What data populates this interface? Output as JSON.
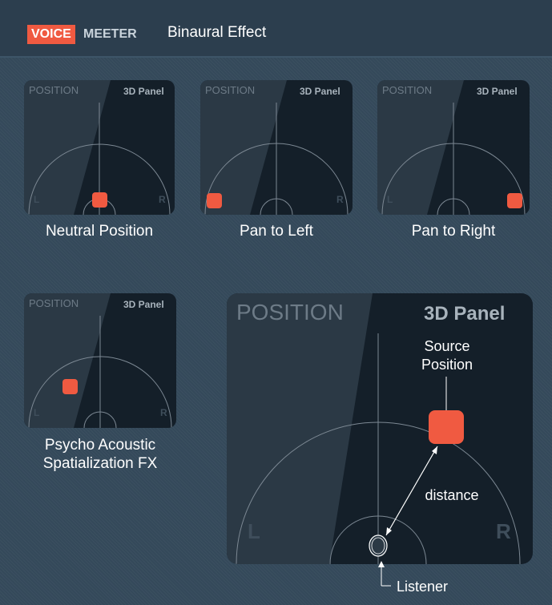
{
  "header": {
    "logo_voice": "VOICE",
    "logo_meeter": "MEETER",
    "title": "Binaural Effect"
  },
  "panel_labels": {
    "position": "POSITION",
    "panel": "3D Panel",
    "left": "L",
    "right": "R"
  },
  "small_panels": [
    {
      "caption": "Neutral Position"
    },
    {
      "caption": "Pan to Left"
    },
    {
      "caption": "Pan to Right"
    },
    {
      "caption_line1": "Psycho Acoustic",
      "caption_line2": "Spatialization FX"
    }
  ],
  "large_panel": {
    "source_line1": "Source",
    "source_line2": "Position",
    "distance": "distance",
    "listener": "Listener"
  },
  "colors": {
    "accent": "#f05a41",
    "panel_bg": "#141f29"
  }
}
